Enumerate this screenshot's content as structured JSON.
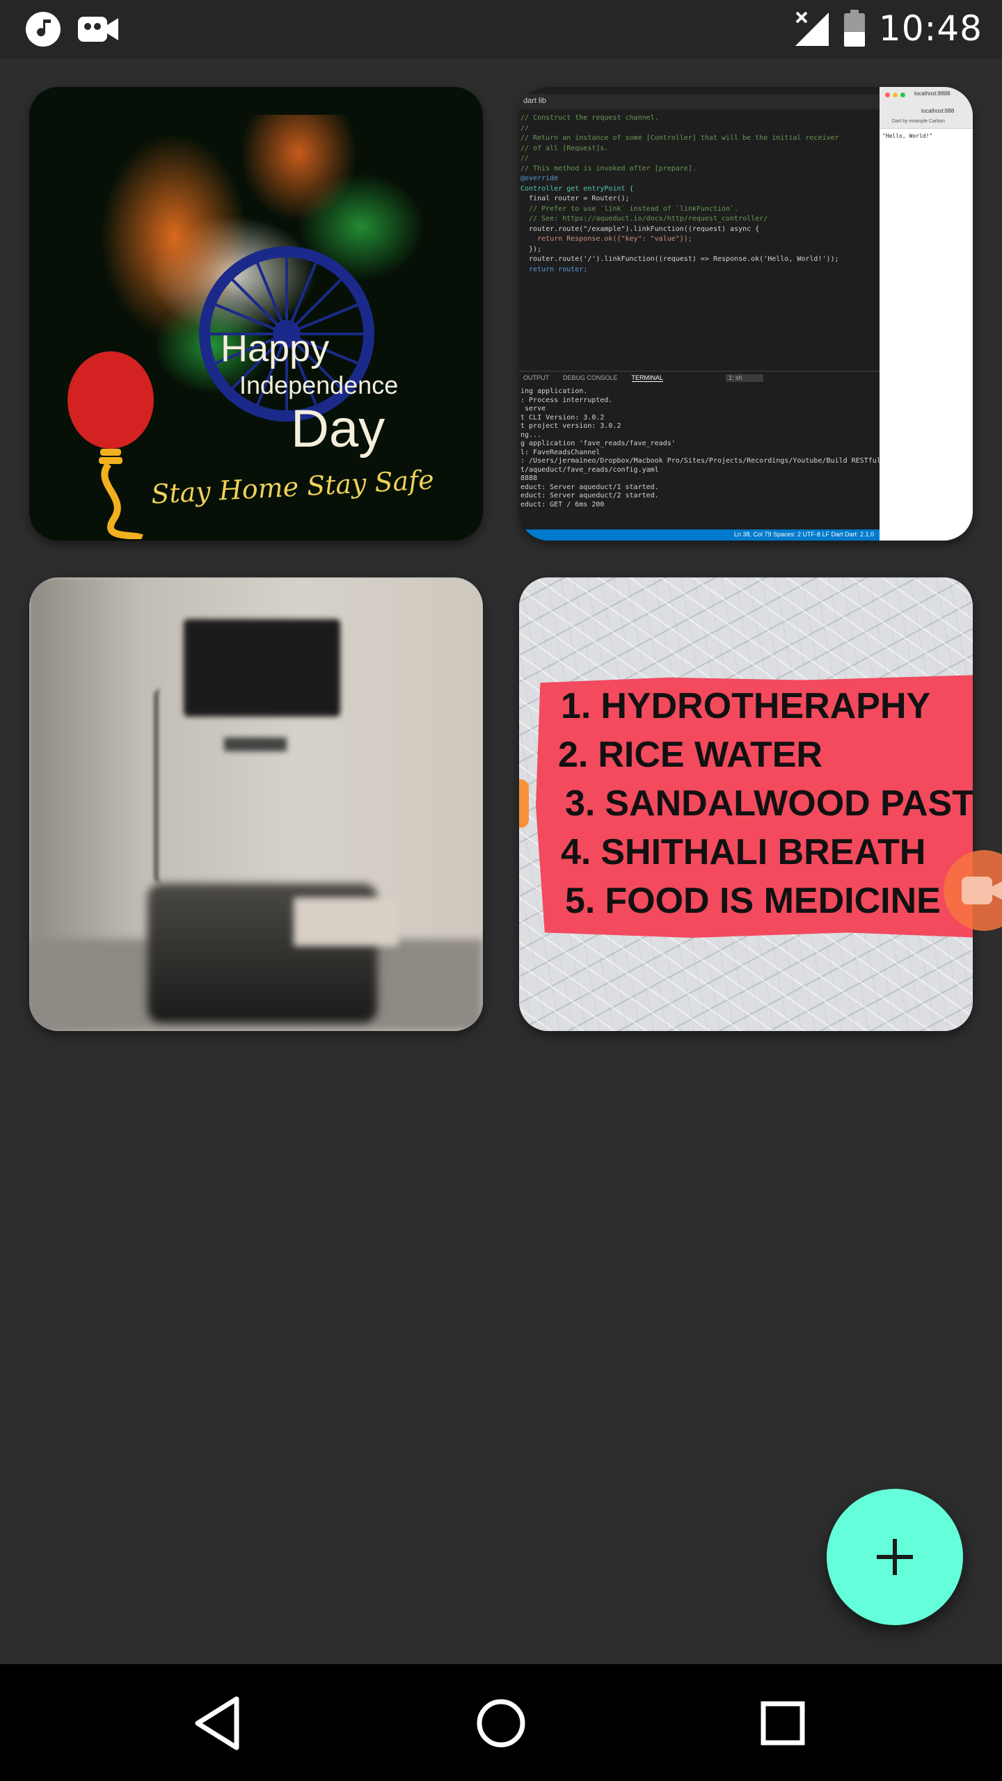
{
  "status_bar": {
    "time": "10:48",
    "left_icons": [
      "music-note-icon",
      "video-camera-icon"
    ],
    "right_icons": [
      "no-signal-icon",
      "battery-icon"
    ]
  },
  "cards": [
    {
      "id": "independence-day",
      "lines": [
        "Happy",
        "Independence",
        "Day",
        "Stay Home Stay Safe"
      ]
    },
    {
      "id": "code-editor",
      "explorer_title": "dart lib",
      "code_lines": [
        "// Construct the request channel.",
        "//",
        "// Return an instance of some [Controller] that will be the initial receiver",
        "// of all [Request]s.",
        "//",
        "// This method is invoked after [prepare].",
        "@override",
        "Controller get entryPoint {",
        "  final router = Router();",
        "",
        "  // Prefer to use `link` instead of `linkFunction`.",
        "  // See: https://aqueduct.io/docs/http/request_controller/",
        "  router.route(\"/example\").linkFunction((request) async {",
        "    return Response.ok({\"key\": \"value\"});",
        "  });",
        "",
        "  router.route('/').linkFunction((request) => Response.ok('Hello, World!'));",
        "",
        "  return router;"
      ],
      "terminal_tabs": [
        "OUTPUT",
        "DEBUG CONSOLE",
        "TERMINAL"
      ],
      "terminal_select": "1: sh",
      "terminal_lines": [
        "ing application.",
        ": Process interrupted.",
        "",
        "",
        " serve",
        "t CLI Version: 3.0.2",
        "t project version: 3.0.2",
        "ng...",
        "g application 'fave_reads/fave_reads'",
        "l: FaveReadsChannel",
        ": /Users/jermaineo/Dropbox/Macbook Pro/Sites/Projects/Recordings/Youtube/Build RESTful A",
        "t/aqueduct/fave_reads/config.yaml",
        "8888",
        "educt: Server aqueduct/1 started.",
        "educt: Server aqueduct/2 started.",
        "educt: GET / 6ms 200"
      ],
      "status_text": "Ln 38, Col 79   Spaces: 2   UTF-8   LF   Dart   Dart: 2.1.0",
      "browser": {
        "tab": "localhost:8888",
        "url": "localhost:888",
        "bookmarks": "Dart by example   Carbon",
        "body": "\"Hello, World!\""
      }
    },
    {
      "id": "blurry-room-photo"
    },
    {
      "id": "remedies-list",
      "items": [
        {
          "num": "1.",
          "text": "HYDROTHERAPHY"
        },
        {
          "num": "2.",
          "text": "RICE WATER"
        },
        {
          "num": "3.",
          "text": "SANDALWOOD PASTE"
        },
        {
          "num": "4.",
          "text": "SHITHALI BREATH"
        },
        {
          "num": "5.",
          "text": "FOOD IS MEDICINE"
        }
      ]
    }
  ],
  "fab": {
    "icon": "plus-icon",
    "color": "#64ffda"
  },
  "floating_bubble": {
    "icon": "video-camera-icon",
    "color": "#f77440"
  },
  "nav_bar": {
    "icons": [
      "back-icon",
      "home-icon",
      "recents-icon"
    ]
  }
}
